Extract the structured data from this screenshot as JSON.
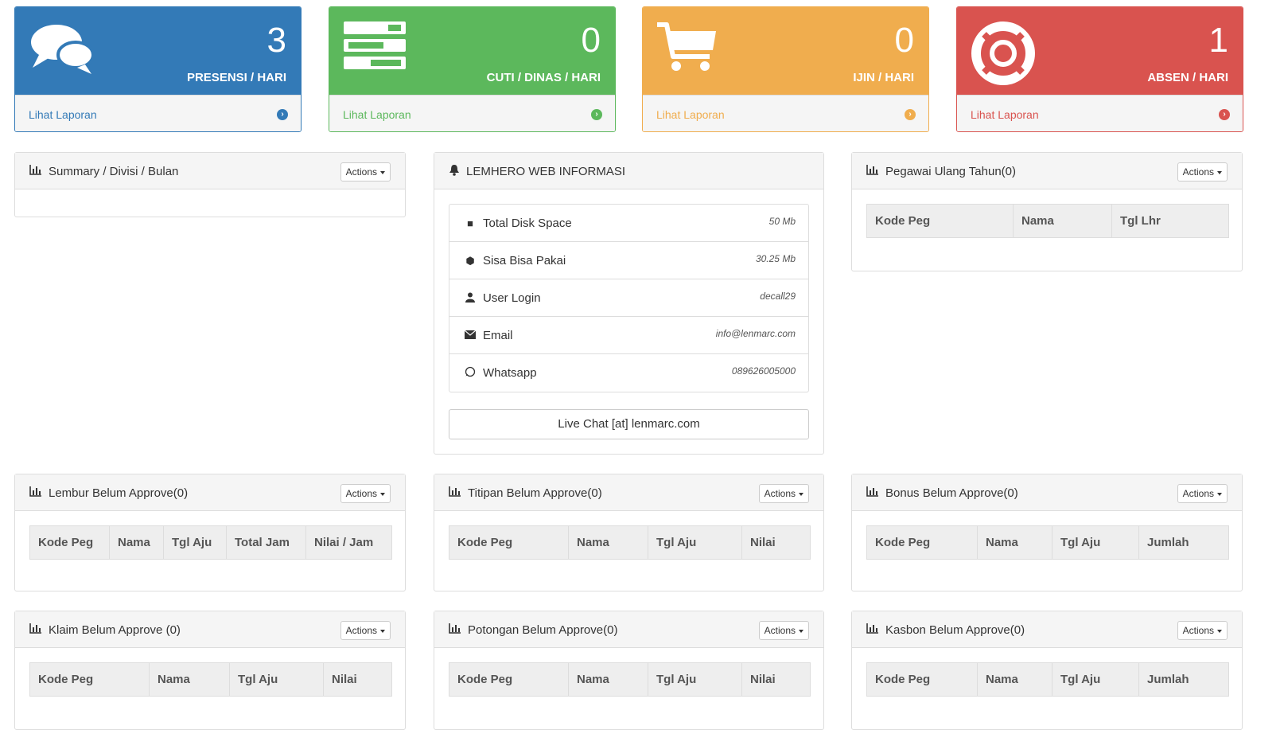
{
  "cards": [
    {
      "count": "3",
      "caption": "PRESENSI / HARI",
      "link": "Lihat Laporan",
      "icon": "comments-icon",
      "color": "#337ab7"
    },
    {
      "count": "0",
      "caption": "CUTI / DINAS / HARI",
      "link": "Lihat Laporan",
      "icon": "tasks-icon",
      "color": "#5cb85c"
    },
    {
      "count": "0",
      "caption": "IJIN / HARI",
      "link": "Lihat Laporan",
      "icon": "shopping-cart-icon",
      "color": "#f0ad4e"
    },
    {
      "count": "1",
      "caption": "ABSEN / HARI",
      "link": "Lihat Laporan",
      "icon": "life-ring-icon",
      "color": "#d9534f"
    }
  ],
  "actions_label": "Actions",
  "summary": {
    "title": "Summary / Divisi / Bulan"
  },
  "info": {
    "title": "LEMHERO WEB INFORMASI",
    "rows": [
      {
        "label": "Total Disk Space",
        "value": "50 Mb",
        "icon": "hdd-icon"
      },
      {
        "label": "Sisa Bisa Pakai",
        "value": "30.25 Mb",
        "icon": "cube-icon"
      },
      {
        "label": "User Login",
        "value": "decall29",
        "icon": "user-icon"
      },
      {
        "label": "Email",
        "value": "info@lenmarc.com",
        "icon": "envelope-icon"
      },
      {
        "label": "Whatsapp",
        "value": "089626005000",
        "icon": "whatsapp-icon"
      }
    ],
    "chat_button": "Live Chat [at] lenmarc.com"
  },
  "birthday": {
    "title": "Pegawai Ulang Tahun(0)",
    "columns": [
      "Kode Peg",
      "Nama",
      "Tgl Lhr"
    ]
  },
  "lembur": {
    "title": "Lembur Belum Approve(0)",
    "columns": [
      "Kode Peg",
      "Nama",
      "Tgl Aju",
      "Total Jam",
      "Nilai / Jam"
    ]
  },
  "titipan": {
    "title": "Titipan Belum Approve(0)",
    "columns": [
      "Kode Peg",
      "Nama",
      "Tgl Aju",
      "Nilai"
    ]
  },
  "bonus": {
    "title": "Bonus Belum Approve(0)",
    "columns": [
      "Kode Peg",
      "Nama",
      "Tgl Aju",
      "Jumlah"
    ]
  },
  "klaim": {
    "title": "Klaim Belum Approve (0)",
    "columns": [
      "Kode Peg",
      "Nama",
      "Tgl Aju",
      "Nilai"
    ]
  },
  "potongan": {
    "title": "Potongan Belum Approve(0)",
    "columns": [
      "Kode Peg",
      "Nama",
      "Tgl Aju",
      "Nilai"
    ]
  },
  "kasbon": {
    "title": "Kasbon Belum Approve(0)",
    "columns": [
      "Kode Peg",
      "Nama",
      "Tgl Aju",
      "Jumlah"
    ]
  }
}
